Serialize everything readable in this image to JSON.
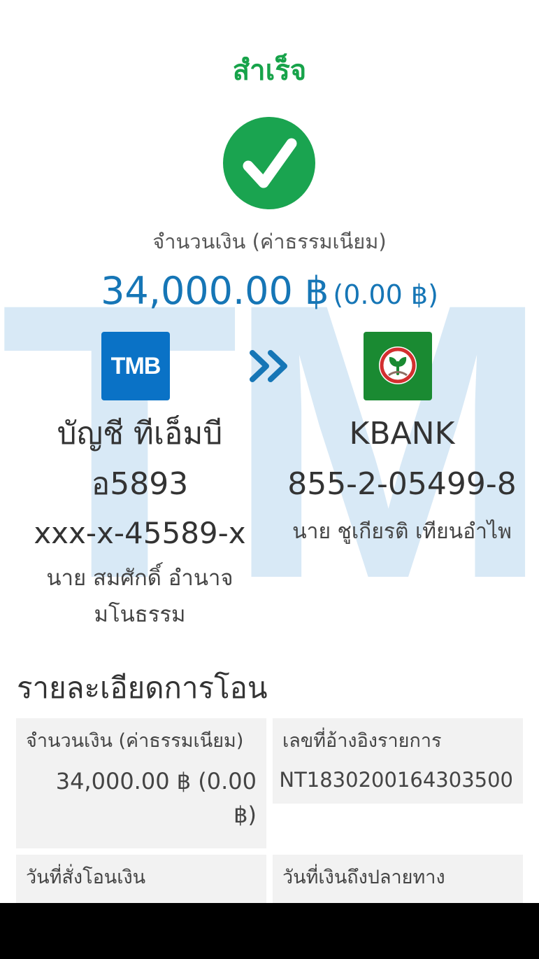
{
  "header": {
    "title": "สำเร็จ"
  },
  "watermark": "TMB",
  "amount": {
    "label": "จำนวนเงิน (ค่าธรรมเนียม)",
    "value": "34,000.00 ฿",
    "fee": "(0.00 ฿)"
  },
  "logos": {
    "from_logo_text": "TMB",
    "from_logo_color": "#0A72C6",
    "to_logo_color": "#1A8A32"
  },
  "from": {
    "account_name_line1": "บัญชี ทีเอ็มบี",
    "account_name_line2": "อ5893",
    "account_number": "xxx-x-45589-x",
    "owner": "นาย สมศักดิ์ อำนาจ มโนธรรม"
  },
  "to": {
    "bank": "KBANK",
    "account_number": "855-2-05499-8",
    "owner": "นาย ชูเกียรติ เทียนอำไพ"
  },
  "details": {
    "title": "รายละเอียดการโอน",
    "amount_label": "จำนวนเงิน (ค่าธรรมเนียม)",
    "amount_value": "34,000.00 ฿ (0.00 ฿)",
    "ref_label": "เลขที่อ้างอิงรายการ",
    "ref_value": "NT1830200164303500",
    "order_date_label": "วันที่สั่งโอนเงิน",
    "arrival_date_label": "วันที่เงินถึงปลายทาง"
  },
  "colors": {
    "success_green": "#17A34A",
    "amount_blue": "#1676B6",
    "watermark": "#D8E9F6"
  }
}
